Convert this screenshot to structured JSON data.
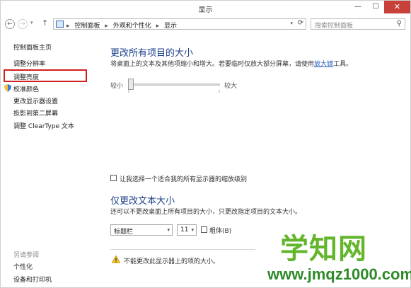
{
  "window": {
    "title": "显示",
    "min_glyph": "—",
    "max_glyph": "☐",
    "close_glyph": "✕"
  },
  "nav": {
    "back_glyph": "←",
    "forward_glyph": "→",
    "dropdown_glyph": "▾",
    "up_glyph": "↑",
    "breadcrumb": [
      "控制面板",
      "外观和个性化",
      "显示"
    ],
    "separator": "▸",
    "refresh_glyph": "⟳",
    "search_placeholder": "搜索控制面板",
    "search_glyph": "⚲"
  },
  "sidebar": {
    "home": "控制面板主页",
    "items": [
      {
        "label": "调整分辨率"
      },
      {
        "label": "调整亮度"
      },
      {
        "label": "校准颜色"
      },
      {
        "label": "更改显示器设置"
      },
      {
        "label": "投影到第二屏幕"
      },
      {
        "label": "调整 ClearType 文本"
      }
    ],
    "see_also_title": "另请参阅",
    "see_also": [
      {
        "label": "个性化"
      },
      {
        "label": "设备和打印机"
      }
    ],
    "highlight_color": "#d12020"
  },
  "main": {
    "size_title": "更改所有项目的大小",
    "size_desc_pre": "将桌面上的文本及其他项缩小和增大。若要临时仅放大部分屏幕，请使用",
    "size_desc_link": "放大镜",
    "size_desc_post": "工具。",
    "slider_small": "较小",
    "slider_large": "较大",
    "slider_value": 0,
    "scale_checkbox": "让我选择一个适合我的所有显示器的缩放级别",
    "text_title": "仅更改文本大小",
    "text_desc": "还可以不更改桌面上所有项目的大小，只更改指定项目的文本大小。",
    "element_select": "标题栏",
    "size_select": "11",
    "bold_label": "粗体(B)",
    "warning": "不能更改此显示器上的项的大小。"
  },
  "watermark": {
    "main": "学知网",
    "url": "www.jmqz1000.com"
  },
  "colors": {
    "heading": "#1b3f8b",
    "link": "#2c5db8",
    "close_btn": "#c7413a",
    "watermark_main": "#63b52c",
    "watermark_url": "#2e8a29"
  }
}
